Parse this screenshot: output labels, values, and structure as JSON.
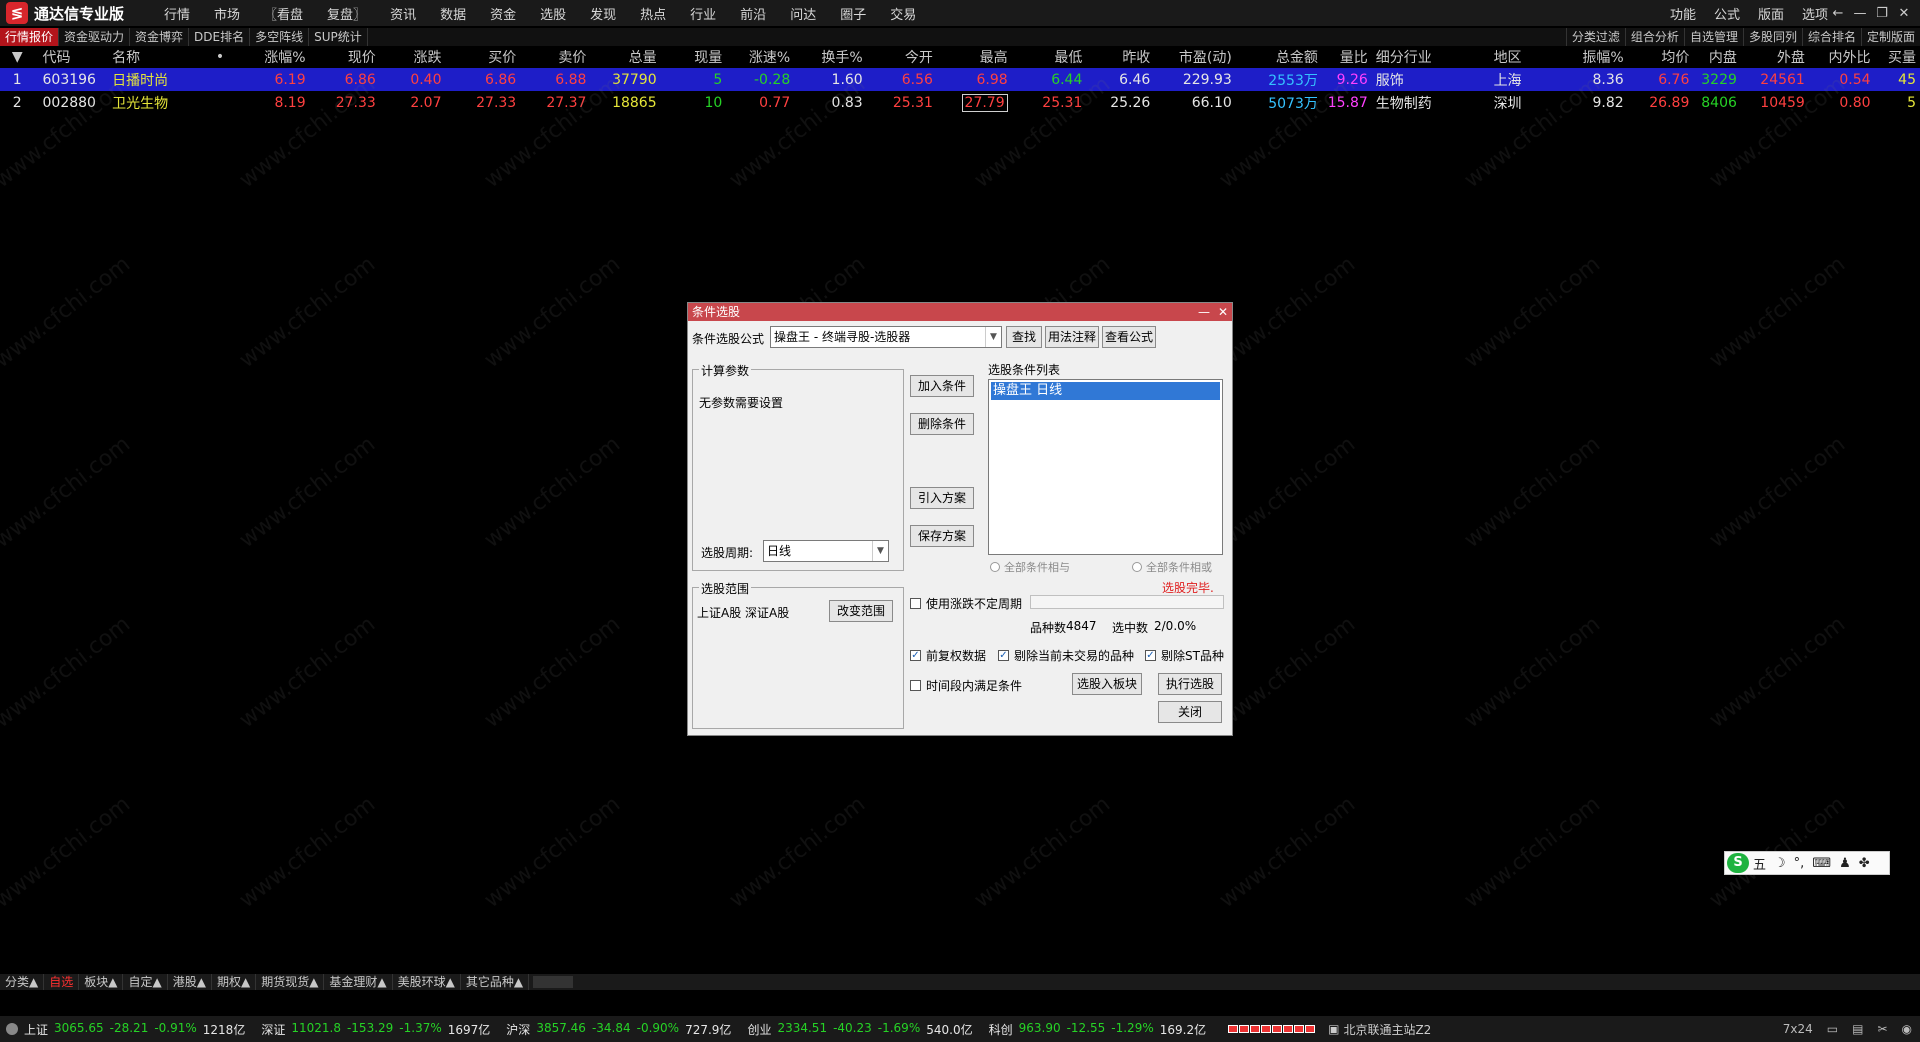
{
  "app": {
    "title": "通达信专业版",
    "logo_char": "≶",
    "menu": [
      "行情",
      "市场",
      "〖看盘",
      "复盘〗",
      "资讯",
      "数据",
      "资金",
      "选股",
      "发现",
      "热点",
      "行业",
      "前沿",
      "问达",
      "圈子",
      "交易"
    ],
    "right_menu": [
      "功能",
      "公式",
      "版面",
      "选项"
    ],
    "window_controls": [
      "←",
      "—",
      "❐",
      "✕"
    ]
  },
  "tabs": {
    "left": [
      "行情报价",
      "资金驱动力",
      "资金博弈",
      "DDE排名",
      "多空阵线",
      "SUP统计"
    ],
    "right": [
      "分类过滤",
      "组合分析",
      "自选管理",
      "多股同列",
      "综合排名",
      "定制版面"
    ]
  },
  "table": {
    "headers": [
      "▼",
      "代码",
      "名称",
      "•",
      "涨幅%",
      "现价",
      "涨跌",
      "买价",
      "卖价",
      "总量",
      "现量",
      "涨速%",
      "换手%",
      "今开",
      "最高",
      "最低",
      "昨收",
      "市盈(动)",
      "总金额",
      "量比",
      "细分行业",
      "地区",
      "振幅%",
      "均价",
      "内盘",
      "外盘",
      "内外比",
      "买量"
    ],
    "rows": [
      [
        "1",
        "603196",
        "日播时尚",
        "",
        "6.19",
        "6.86",
        "0.40",
        "6.86",
        "6.88",
        "37790",
        "5",
        "-0.28",
        "1.60",
        "6.56",
        "6.98",
        "6.44",
        "6.46",
        "229.93",
        "2553万",
        "9.26",
        "服饰",
        "上海",
        "8.36",
        "6.76",
        "3229",
        "24561",
        "0.54",
        "45"
      ],
      [
        "2",
        "002880",
        "卫光生物",
        "",
        "8.19",
        "27.33",
        "2.07",
        "27.33",
        "27.37",
        "18865",
        "10",
        "0.77",
        "0.83",
        "25.31",
        "27.79",
        "25.31",
        "25.26",
        "66.10",
        "5073万",
        "15.87",
        "生物制药",
        "深圳",
        "9.82",
        "26.89",
        "8406",
        "10459",
        "0.80",
        "5"
      ]
    ]
  },
  "watermark": "www.cfchi.com",
  "dialog": {
    "title": "条件选股",
    "formula_label": "条件选股公式",
    "formula_value": "操盘王      - 终端寻股-选股器",
    "find_button": "查找",
    "usage_button": "用法注释",
    "view_formula_button": "查看公式",
    "params_group": "计算参数",
    "no_params": "无参数需要设置",
    "period_label": "选股周期:",
    "period_value": "日线",
    "add_condition": "加入条件",
    "delete_condition": "删除条件",
    "import_plan": "引入方案",
    "save_plan": "保存方案",
    "condition_list_label": "选股条件列表",
    "condition_item": "操盘王  日线",
    "radio_and": "全部条件相与",
    "radio_or": "全部条件相或",
    "status": "选股完毕.",
    "range_group": "选股范围",
    "range_value": "上证A股 深证A股",
    "change_range": "改变范围",
    "use_uncertain_period": "使用涨跌不定周期",
    "count_label": "品种数",
    "count_value": "4847",
    "selected_label": "选中数",
    "selected_value": "2/0.0%",
    "forward_adjust": "前复权数据",
    "remove_untraded": "剔除当前未交易的品种",
    "remove_st": "剔除ST品种",
    "time_period_satisfy": "时间段内满足条件",
    "to_block": "选股入板块",
    "execute": "执行选股",
    "close": "关闭"
  },
  "category_bar": [
    "分类▲",
    "自选",
    "板块▲",
    "自定▲",
    "港股▲",
    "期权▲",
    "期货现货▲",
    "基金理财▲",
    "美股环球▲",
    "其它品种▲"
  ],
  "status_bar": {
    "indices": [
      {
        "name": "上证",
        "value": "3065.65",
        "change": "-28.21",
        "pct": "-0.91%",
        "amount": "1218亿"
      },
      {
        "name": "深证",
        "value": "11021.8",
        "change": "-153.29",
        "pct": "-1.37%",
        "amount": "1697亿"
      },
      {
        "name": "沪深",
        "value": "3857.46",
        "change": "-34.84",
        "pct": "-0.90%",
        "amount": "727.9亿"
      },
      {
        "name": "创业",
        "value": "2334.51",
        "change": "-40.23",
        "pct": "-1.69%",
        "amount": "540.0亿"
      },
      {
        "name": "科创",
        "value": "963.90",
        "change": "-12.55",
        "pct": "-1.29%",
        "amount": "169.2亿"
      }
    ],
    "server": "北京联通主站Z2",
    "service": "7x24"
  },
  "ime": {
    "logo": "S",
    "mode": "五",
    "icons": [
      "☽",
      "°,",
      "⌨",
      "♟",
      "✤"
    ]
  }
}
